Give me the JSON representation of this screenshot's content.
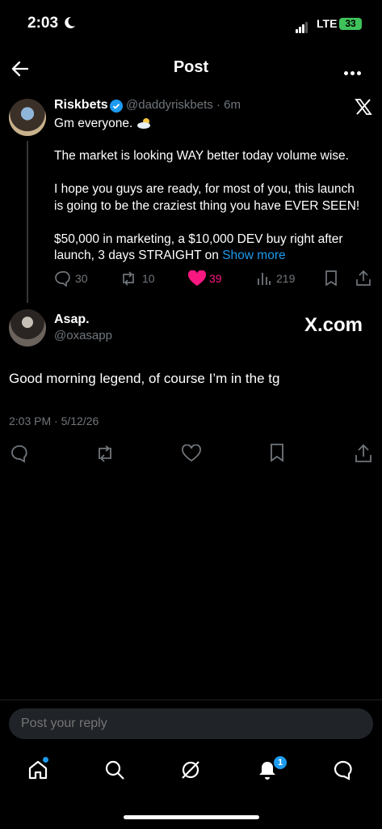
{
  "status_bar": {
    "time": "2:03",
    "network": "LTE",
    "battery": "33"
  },
  "header": {
    "title": "Post"
  },
  "parent_post": {
    "name": "Riskbets",
    "handle_time": "@daddyriskbets · 6m",
    "lines": [
      "Gm everyone.",
      "The market is looking WAY better today volume wise.",
      "I hope you guys are ready, for most of you, this launch",
      "is going to be the craziest thing you have EVER SEEN!",
      "$50,000 in marketing, a $10,000 DEV buy right after",
      "launch, 3 days STRAIGHT on"
    ],
    "show_more": "Show more",
    "replies": "30",
    "reposts": "10",
    "likes": "39",
    "views": "219"
  },
  "main_post": {
    "name": "Asap.",
    "handle": "@oxasapp",
    "watermark": "X.com",
    "body": "Good morning legend, of course I’m in the tg",
    "timestamp": "2:03 PM · 5/12/26"
  },
  "reply_bar": {
    "placeholder": "Post your reply"
  },
  "bottom_nav": {
    "notifications_count": "1"
  },
  "colors": {
    "accent": "#1d9bf0",
    "like": "#f91880",
    "muted": "#71767b"
  }
}
